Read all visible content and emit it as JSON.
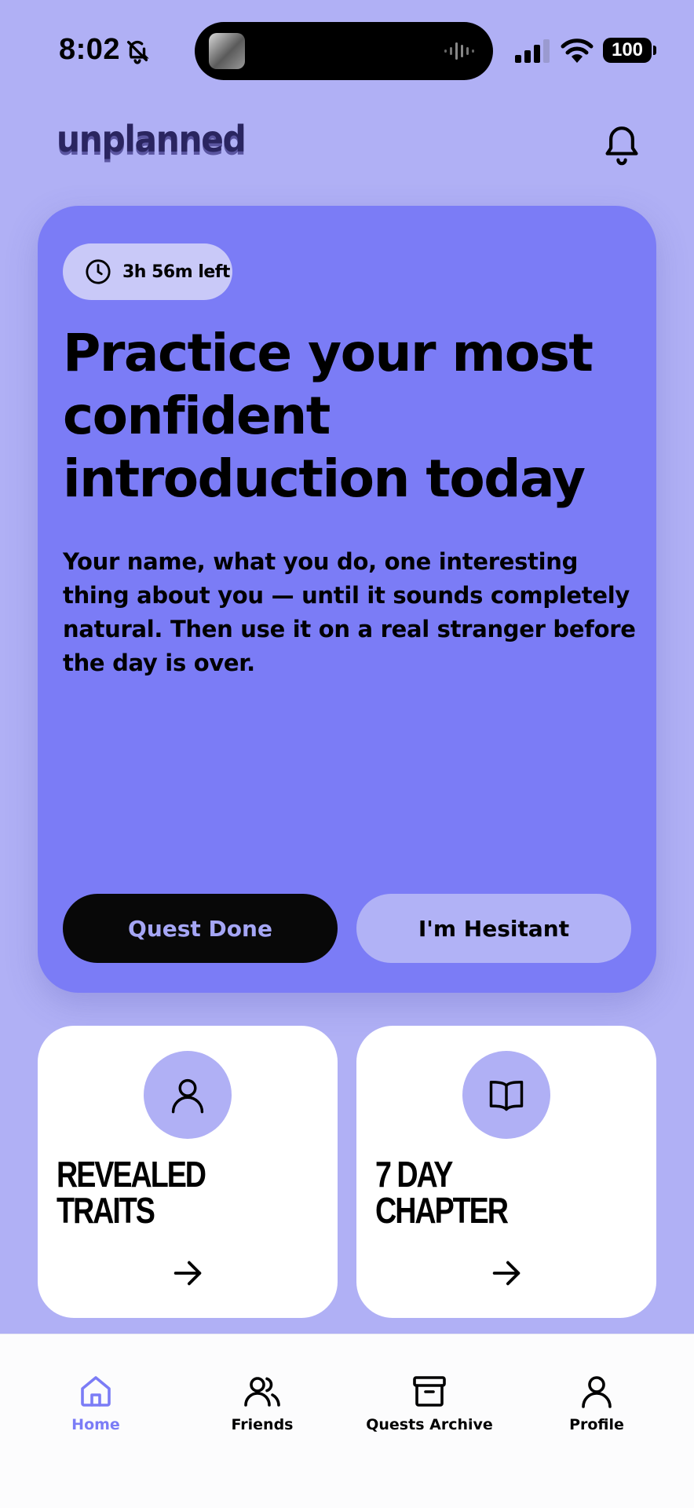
{
  "status_bar": {
    "time": "8:02",
    "battery": "100",
    "icons": [
      "bell-slash-icon",
      "signal-icon",
      "wifi-icon",
      "battery-icon"
    ]
  },
  "header": {
    "logo": "unplanned",
    "notification_icon": "bell-icon"
  },
  "quest": {
    "timer_icon": "clock-icon",
    "timer_text": "3h 56m left",
    "title": "Practice your most confident introduction today",
    "description": "Your name, what you do, one interesting thing about you — until it sounds completely natural. Then use it on a real stranger before the day is over.",
    "primary_button": "Quest Done",
    "secondary_button": "I'm Hesitant"
  },
  "cards": [
    {
      "icon": "person-icon",
      "title": "REVEALED\nTRAITS",
      "arrow_icon": "arrow-right-icon"
    },
    {
      "icon": "book-icon",
      "title": "7 DAY\nCHAPTER",
      "arrow_icon": "arrow-right-icon"
    }
  ],
  "bottom_nav": {
    "items": [
      {
        "label": "Home",
        "icon": "home-icon",
        "active": true
      },
      {
        "label": "Friends",
        "icon": "friends-icon",
        "active": false
      },
      {
        "label": "Quests Archive",
        "icon": "archive-icon",
        "active": false
      },
      {
        "label": "Profile",
        "icon": "profile-icon",
        "active": false
      }
    ]
  },
  "colors": {
    "background": "#b0b0f5",
    "card_accent": "#7b7cf6",
    "pill": "#c9c9f8",
    "logo": "#2a2560",
    "active_nav": "#7b7cf6"
  }
}
